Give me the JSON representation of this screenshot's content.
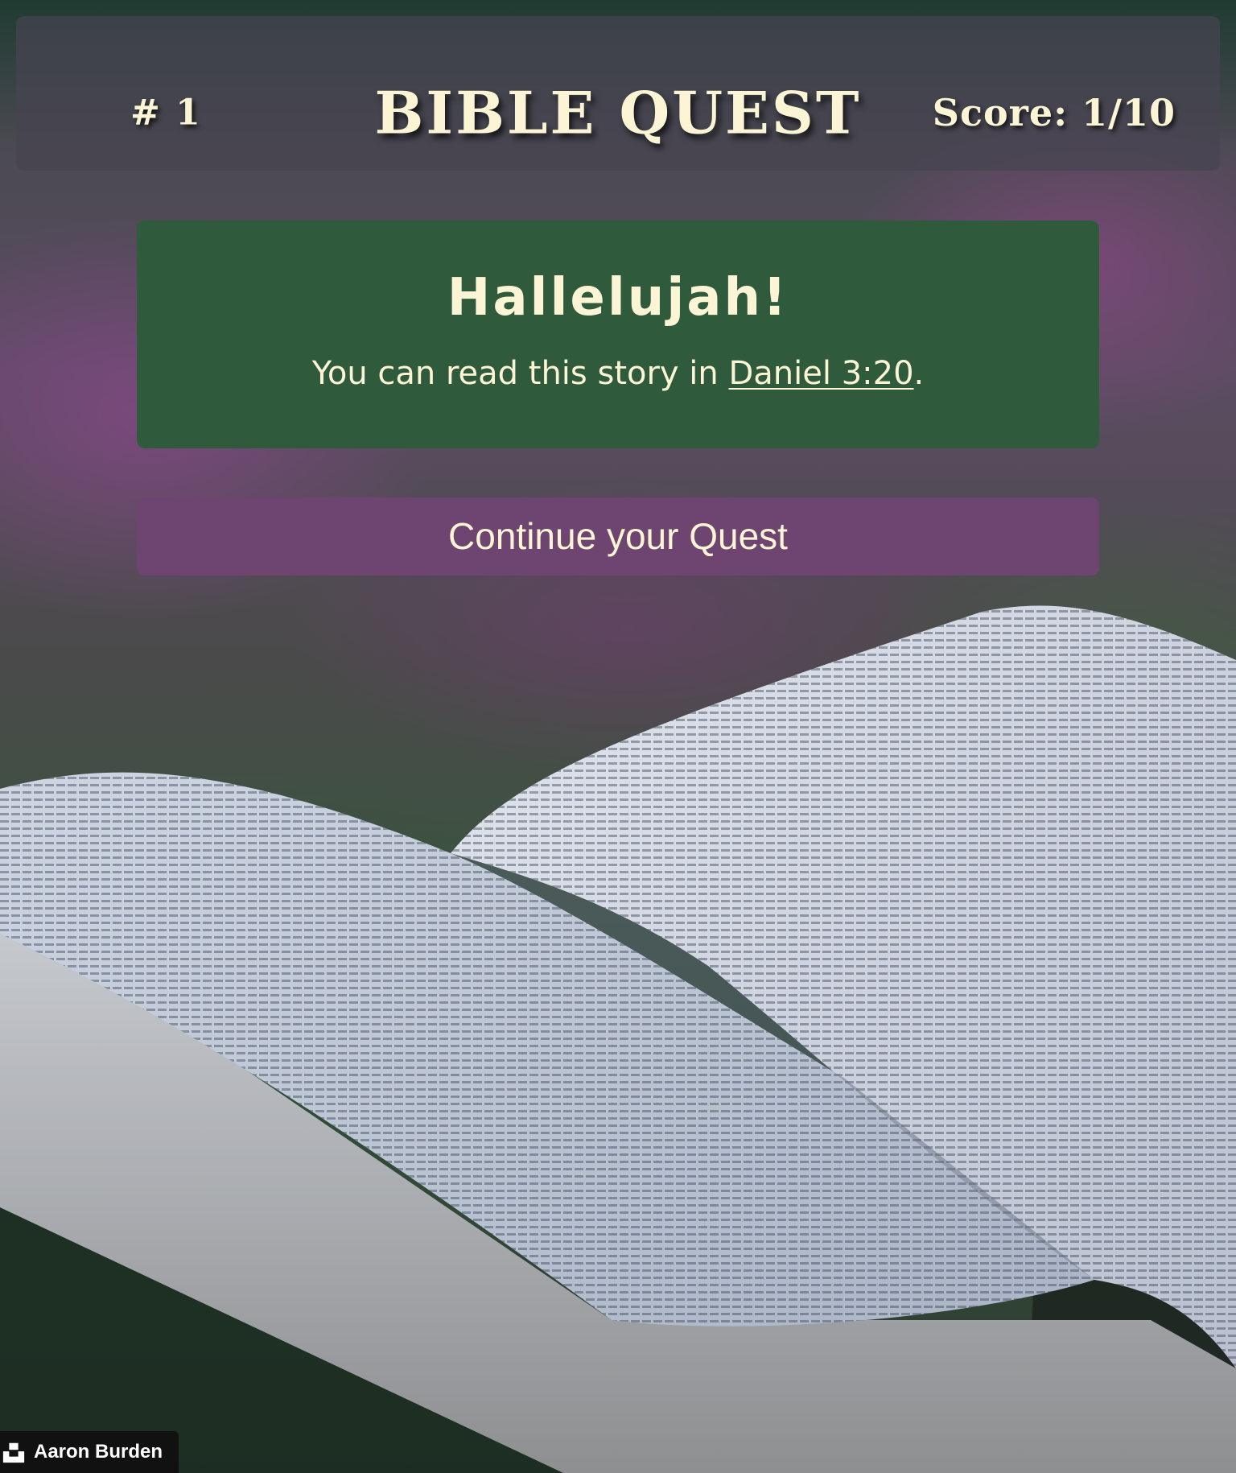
{
  "header": {
    "counter": "# 1",
    "title": "BIBLE QUEST",
    "score": "Score: 1/10"
  },
  "result": {
    "heading": "Hallelujah!",
    "text_before": "You can read this story in ",
    "reference_link": "Daniel 3:20",
    "text_after": "."
  },
  "actions": {
    "continue_label": "Continue your Quest"
  },
  "credit": {
    "icon": "unsplash-icon",
    "photographer": "Aaron Burden"
  },
  "colors": {
    "header_bg": "#46445055",
    "result_card_bg": "#305a3c",
    "continue_button_bg": "#6e4470",
    "text_cream": "#fbf5d5"
  }
}
